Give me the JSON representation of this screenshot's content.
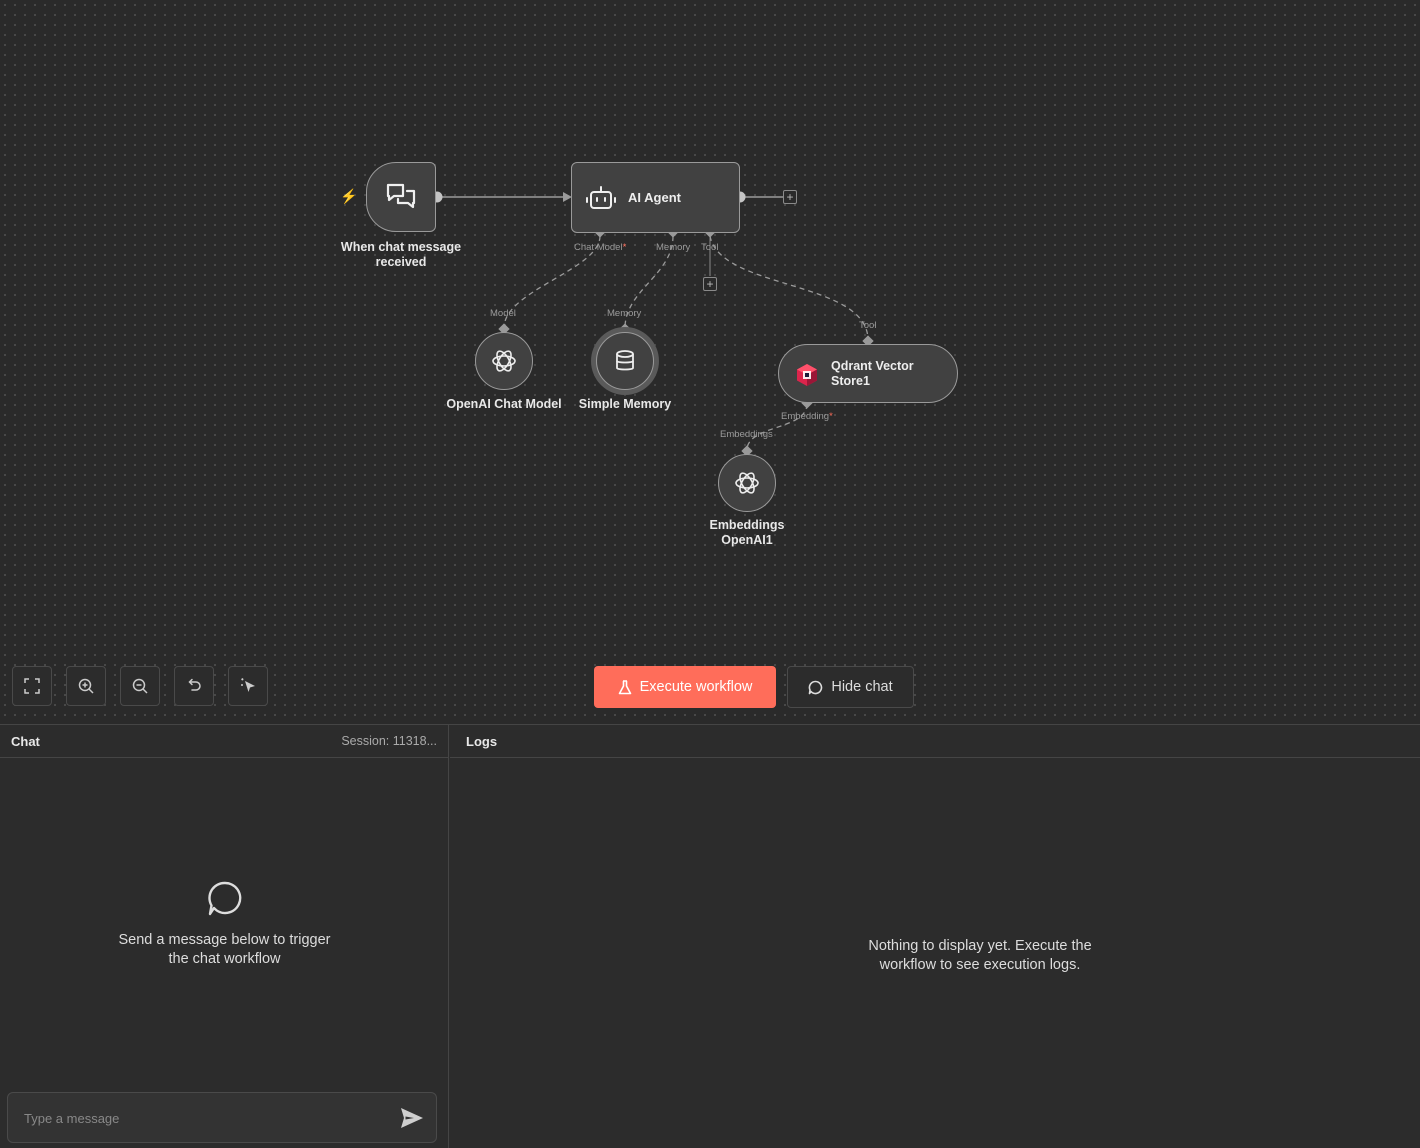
{
  "canvas": {
    "nodes": {
      "trigger": {
        "label": "When chat message\nreceived"
      },
      "agent": {
        "label": "AI Agent",
        "ports": {
          "chat_model": "Chat Model",
          "required_mark": "*",
          "memory": "Memory",
          "tool": "Tool"
        }
      },
      "openai_chat": {
        "label": "OpenAI Chat Model",
        "port": "Model"
      },
      "memory": {
        "label": "Simple Memory",
        "port": "Memory"
      },
      "qdrant": {
        "label": "Qdrant Vector\nStore1",
        "port_top": "Tool",
        "port_bottom": "Embedding",
        "required_mark": "*"
      },
      "embeddings": {
        "label": "Embeddings\nOpenAI1",
        "port": "Embeddings"
      }
    },
    "plus": "+"
  },
  "toolbar": {
    "icons": [
      "fit-view-icon",
      "zoom-in-icon",
      "zoom-out-icon",
      "reset-zoom-icon",
      "tidy-up-icon"
    ],
    "execute_label": "Execute workflow",
    "hide_chat_label": "Hide chat"
  },
  "chat": {
    "title": "Chat",
    "session": "Session: 11318...",
    "empty_text": "Send a message below to trigger\nthe chat workflow",
    "input_placeholder": "Type a message"
  },
  "logs": {
    "title": "Logs",
    "empty_text": "Nothing to display yet. Execute the\nworkflow to see execution logs."
  },
  "colors": {
    "accent": "#ff6d5a",
    "background": "#2a2a2a",
    "node": "#414141",
    "border": "#9a9a9a"
  }
}
